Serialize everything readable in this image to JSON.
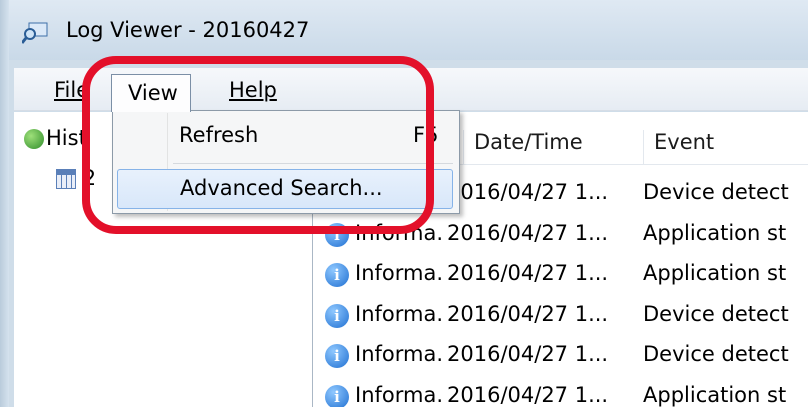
{
  "window": {
    "title": "Log Viewer - 20160427"
  },
  "menubar": {
    "file": {
      "label": "File"
    },
    "view": {
      "label": "View"
    },
    "help": {
      "label": "Help"
    }
  },
  "dropdown": {
    "refresh": {
      "label": "Refresh",
      "shortcut": "F5"
    },
    "advanced_search": {
      "label": "Advanced Search..."
    }
  },
  "tree": {
    "root_label": "Hist",
    "child_label": "2"
  },
  "list": {
    "columns": {
      "date": "Date/Time",
      "event": "Event"
    },
    "rows": [
      {
        "level": "",
        "date": "2016/04/27 1...",
        "event": "Device detect"
      },
      {
        "level": "Informa.",
        "date": "2016/04/27 1...",
        "event": "Application st"
      },
      {
        "level": "Informa.",
        "date": "2016/04/27 1...",
        "event": "Application st"
      },
      {
        "level": "Informa.",
        "date": "2016/04/27 1...",
        "event": "Device detect"
      },
      {
        "level": "Informa.",
        "date": "2016/04/27 1...",
        "event": "Device detect"
      },
      {
        "level": "Informa.",
        "date": "2016/04/27 1...",
        "event": "Application st"
      }
    ]
  },
  "colors": {
    "highlight": "#e3102a",
    "selection": "#d8e7fa"
  }
}
